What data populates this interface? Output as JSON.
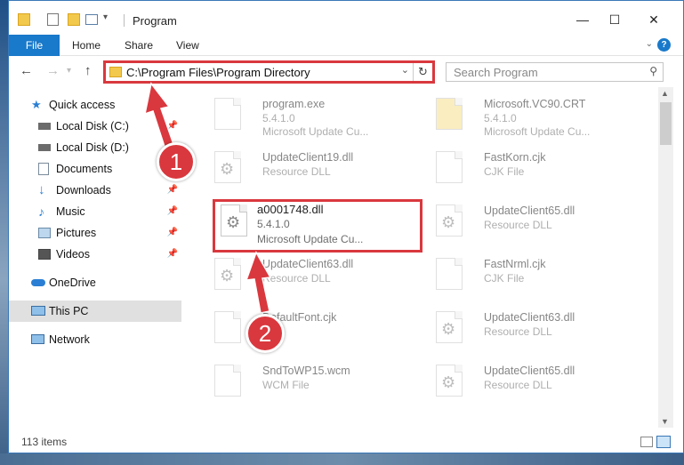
{
  "window": {
    "title": "Program",
    "minimize": "—",
    "maximize": "☐",
    "close": "✕"
  },
  "ribbon": {
    "tabs": [
      "File",
      "Home",
      "Share",
      "View"
    ],
    "help": "?"
  },
  "nav": {
    "back": "←",
    "forward": "→",
    "up": "↑",
    "address": "C:\\Program Files\\Program Directory",
    "search_placeholder": "Search Program"
  },
  "sidebar": {
    "items": [
      {
        "label": "Quick access",
        "icon": "star-icon",
        "pinned": false
      },
      {
        "label": "Local Disk (C:)",
        "icon": "drive-icon",
        "pinned": true
      },
      {
        "label": "Local Disk (D:)",
        "icon": "drive-icon",
        "pinned": false
      },
      {
        "label": "Documents",
        "icon": "documents-icon",
        "pinned": true
      },
      {
        "label": "Downloads",
        "icon": "download-icon",
        "pinned": true
      },
      {
        "label": "Music",
        "icon": "music-icon",
        "pinned": true
      },
      {
        "label": "Pictures",
        "icon": "pictures-icon",
        "pinned": true
      },
      {
        "label": "Videos",
        "icon": "videos-icon",
        "pinned": true
      },
      {
        "label": "OneDrive",
        "icon": "cloud-icon",
        "pinned": false
      },
      {
        "label": "This PC",
        "icon": "computer-icon",
        "pinned": false,
        "selected": true
      },
      {
        "label": "Network",
        "icon": "network-icon",
        "pinned": false
      }
    ]
  },
  "files": [
    {
      "name": "program.exe",
      "l2": "5.4.1.0",
      "l3": "Microsoft Update Cu..."
    },
    {
      "name": "Microsoft.VC90.CRT",
      "l2": "5.4.1.0",
      "l3": "Microsoft Update Cu..."
    },
    {
      "name": "UpdateClient19.dll",
      "l2": "Resource DLL",
      "l3": ""
    },
    {
      "name": "FastKorn.cjk",
      "l2": "CJK File",
      "l3": ""
    },
    {
      "name": "a0001748.dll",
      "l2": "5.4.1.0",
      "l3": "Microsoft Update Cu...",
      "highlighted": true
    },
    {
      "name": "UpdateClient65.dll",
      "l2": "Resource DLL",
      "l3": ""
    },
    {
      "name": "UpdateClient63.dll",
      "l2": "Resource DLL",
      "l3": ""
    },
    {
      "name": "FastNrml.cjk",
      "l2": "CJK File",
      "l3": ""
    },
    {
      "name": "DefaultFont.cjk",
      "l2": "",
      "l3": ""
    },
    {
      "name": "UpdateClient63.dll",
      "l2": "Resource DLL",
      "l3": ""
    },
    {
      "name": "SndToWP15.wcm",
      "l2": "WCM File",
      "l3": ""
    },
    {
      "name": "UpdateClient65.dll",
      "l2": "Resource DLL",
      "l3": ""
    }
  ],
  "status": {
    "count": "113 items"
  },
  "callouts": {
    "one": "1",
    "two": "2",
    "color": "#d9383e"
  }
}
